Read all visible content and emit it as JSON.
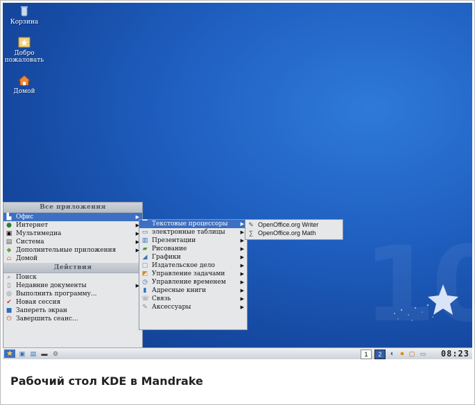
{
  "desktop": {
    "icons": [
      {
        "label": "Корзина",
        "icon": "trash-icon"
      },
      {
        "label": "Добро пожаловать",
        "icon": "star-welcome-icon"
      },
      {
        "label": "Домой",
        "icon": "home-icon"
      }
    ],
    "watermark": "10"
  },
  "kmenu": {
    "header_apps": "Все приложения",
    "apps": [
      {
        "label": "Офис",
        "icon": "office-icon",
        "submenu": true,
        "selected": true
      },
      {
        "label": "Интернет",
        "icon": "globe-icon",
        "submenu": true
      },
      {
        "label": "Мультимедиа",
        "icon": "multimedia-icon",
        "submenu": true
      },
      {
        "label": "Система",
        "icon": "system-icon",
        "submenu": true
      },
      {
        "label": "Дополнительные приложения",
        "icon": "more-apps-icon",
        "submenu": true
      },
      {
        "label": "Домой",
        "icon": "home-icon",
        "submenu": false
      }
    ],
    "header_actions": "Действия",
    "actions": [
      {
        "label": "Поиск",
        "icon": "search-icon",
        "submenu": false
      },
      {
        "label": "Недавние документы",
        "icon": "recent-docs-icon",
        "submenu": true
      },
      {
        "label": "Выполнить программу...",
        "icon": "run-icon",
        "submenu": false
      },
      {
        "label": "Новая сессия",
        "icon": "new-session-icon",
        "submenu": false
      },
      {
        "label": "Запереть экран",
        "icon": "lock-icon",
        "submenu": false
      },
      {
        "label": "Завершить сеанс...",
        "icon": "logout-icon",
        "submenu": false
      }
    ]
  },
  "office_submenu": [
    {
      "label": "Текстовые процессоры",
      "icon": "word-processor-icon",
      "selected": true
    },
    {
      "label": "электронные таблицы",
      "icon": "spreadsheet-icon"
    },
    {
      "label": "Презентации",
      "icon": "presentation-icon"
    },
    {
      "label": "Рисование",
      "icon": "drawing-icon"
    },
    {
      "label": "Графики",
      "icon": "charts-icon"
    },
    {
      "label": "Издательское дело",
      "icon": "publishing-icon"
    },
    {
      "label": "Управление задачами",
      "icon": "tasks-icon"
    },
    {
      "label": "Управление временем",
      "icon": "time-icon"
    },
    {
      "label": "Адресные книги",
      "icon": "address-book-icon"
    },
    {
      "label": "Связь",
      "icon": "communication-icon"
    },
    {
      "label": "Аксессуары",
      "icon": "accessories-icon"
    }
  ],
  "word_processors_submenu": [
    {
      "label": "OpenOffice.org Writer",
      "icon": "oo-writer-icon"
    },
    {
      "label": "OpenOffice.org Math",
      "icon": "oo-math-icon"
    }
  ],
  "taskbar": {
    "quicklaunch": [
      "kmenu-icon",
      "home-folder-icon",
      "konqueror-icon",
      "terminal-icon",
      "settings-icon"
    ],
    "desktops": [
      "1",
      "2"
    ],
    "clock": "08:23"
  },
  "caption": "Рабочий стол KDE в Mandrake",
  "colors": {
    "desktop_bg": "#1a55b0",
    "menu_bg": "#e6e7e9",
    "selection": "#3d6fc2"
  }
}
